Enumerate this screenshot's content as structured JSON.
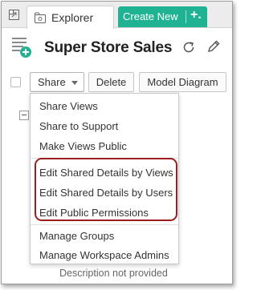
{
  "tabs": {
    "explorer_label": "Explorer",
    "create_new_label": "Create New",
    "create_plus": "+."
  },
  "header": {
    "title": "Super Store Sales"
  },
  "toolbar": {
    "share_label": "Share",
    "delete_label": "Delete",
    "model_diagram_label": "Model Diagram"
  },
  "share_menu": {
    "items": [
      "Share Views",
      "Share to Support",
      "Make Views Public",
      "Edit Shared Details by Views",
      "Edit Shared Details by Users",
      "Edit Public Permissions",
      "Manage Groups",
      "Manage Workspace Admins"
    ]
  },
  "content": {
    "description": "Description not provided"
  },
  "colors": {
    "create_new_bg": "#1fb394",
    "highlight_border": "#9c1d1d"
  },
  "icons": [
    "collapse-icon",
    "explorer-icon",
    "workspace-icon",
    "refresh-icon",
    "edit-pencil-icon",
    "chevron-down-icon"
  ]
}
